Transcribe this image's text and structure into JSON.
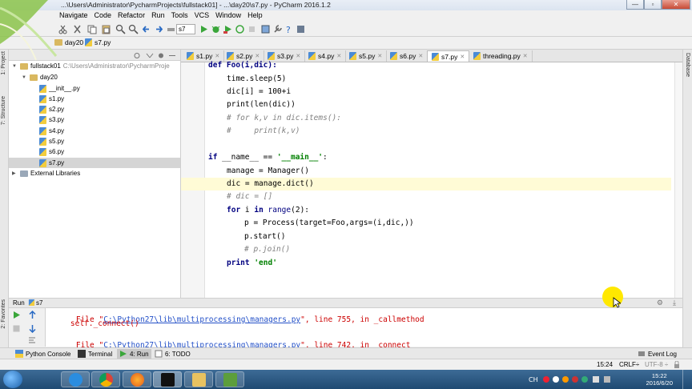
{
  "window": {
    "title": "...\\Users\\Administrator\\PycharmProjects\\fullstack01] - ...\\day20\\s7.py - PyCharm 2016.1.2",
    "minimize": "—",
    "maximize": "▫",
    "close": "✕"
  },
  "menu": [
    "Navigate",
    "Code",
    "Refactor",
    "Run",
    "Tools",
    "VCS",
    "Window",
    "Help"
  ],
  "toolbar": {
    "run_config": "s7"
  },
  "breadcrumb": {
    "folder": "day20",
    "file": "s7.py"
  },
  "left_strip": {
    "project": "1: Project",
    "structure": "7: Structure",
    "favorites": "2: Favorites"
  },
  "right_strip": {
    "database": "Database"
  },
  "project_tree": [
    {
      "label": "fullstack01",
      "path": "C:\\Users\\Administrator\\PycharmProje",
      "kind": "folder",
      "arrow": "▼",
      "depth": 0
    },
    {
      "label": "day20",
      "kind": "folder",
      "arrow": "▼",
      "depth": 1
    },
    {
      "label": "__init__.py",
      "kind": "py",
      "depth": 2
    },
    {
      "label": "s1.py",
      "kind": "py",
      "depth": 2
    },
    {
      "label": "s2.py",
      "kind": "py",
      "depth": 2
    },
    {
      "label": "s3.py",
      "kind": "py",
      "depth": 2
    },
    {
      "label": "s4.py",
      "kind": "py",
      "depth": 2
    },
    {
      "label": "s5.py",
      "kind": "py",
      "depth": 2
    },
    {
      "label": "s6.py",
      "kind": "py",
      "depth": 2
    },
    {
      "label": "s7.py",
      "kind": "py",
      "depth": 2,
      "selected": true
    },
    {
      "label": "External Libraries",
      "kind": "lib",
      "arrow": "▶",
      "depth": 0
    }
  ],
  "editor_tabs": [
    {
      "label": "s1.py"
    },
    {
      "label": "s2.py"
    },
    {
      "label": "s3.py"
    },
    {
      "label": "s4.py"
    },
    {
      "label": "s5.py"
    },
    {
      "label": "s6.py"
    },
    {
      "label": "s7.py",
      "active": true
    },
    {
      "label": "threading.py"
    }
  ],
  "code": {
    "l1": "def Foo(i,dic):",
    "l2": "time.sleep(5)",
    "l3": "dic[i] = 100+i",
    "l4": "print(len(dic))",
    "l5": "# for k,v in dic.items():",
    "l6": "#     print(k,v)",
    "l7_kw": "if",
    "l7_mid": " __name__ == ",
    "l7_str": "'__main__'",
    "l7_end": ":",
    "l8": "manage = Manager()",
    "l9": "dic = manage.dict()",
    "l10": "# dic = []",
    "l11_kw1": "for",
    "l11_mid": " i ",
    "l11_kw2": "in",
    "l11_fn": " range",
    "l11_num": "(2):",
    "l12": "p = Process(target=Foo,args=(i,dic,))",
    "l13": "p.start()",
    "l14": "# p.join()",
    "l15_kw": "print",
    "l15_str": " 'end'"
  },
  "run_panel": {
    "title": "Run",
    "config": "s7",
    "lines": [
      {
        "prefix": "File \"",
        "link": "C:\\Python27\\lib\\multiprocessing\\managers.py",
        "suffix": "\", line 755, in _callmethod"
      },
      {
        "text": "    self._connect()"
      },
      {
        "prefix": "File \"",
        "link": "C:\\Python27\\lib\\multiprocessing\\managers.py",
        "suffix": "\", line 742, in _connect"
      }
    ]
  },
  "tool_windows": [
    {
      "label": "Python Console"
    },
    {
      "label": "Terminal"
    },
    {
      "label": "4: Run",
      "active": true
    },
    {
      "label": "6: TODO"
    }
  ],
  "event_log": "Event Log",
  "status": {
    "position": "15:24",
    "line_sep": "CRLF÷",
    "encoding": "UTF-8 ÷"
  },
  "taskbar": {
    "time": "15:22",
    "date": "2016/6/20"
  },
  "colors": {
    "accent_run": "#3aa63a",
    "highlight": "#ffe800"
  }
}
